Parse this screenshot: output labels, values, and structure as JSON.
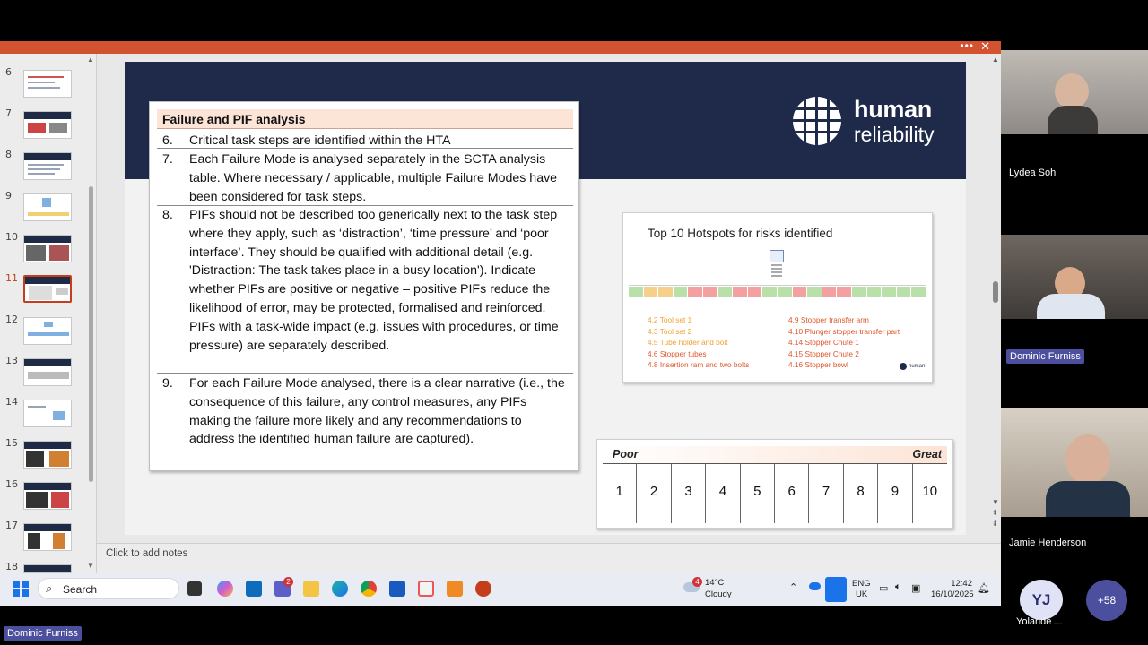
{
  "window": {
    "more_icon": "ellipsis-icon",
    "close_icon": "close-icon"
  },
  "thumbnails": [
    {
      "num": "6"
    },
    {
      "num": "7"
    },
    {
      "num": "8"
    },
    {
      "num": "9"
    },
    {
      "num": "10"
    },
    {
      "num": "11",
      "selected": true
    },
    {
      "num": "12"
    },
    {
      "num": "13"
    },
    {
      "num": "14"
    },
    {
      "num": "15"
    },
    {
      "num": "16"
    },
    {
      "num": "17"
    },
    {
      "num": "18"
    }
  ],
  "slide": {
    "logo": {
      "word1": "human",
      "word2": "reliability"
    },
    "card": {
      "heading": "Failure and PIF analysis",
      "items": [
        {
          "num": "6.",
          "text": "Critical task steps are identified within the HTA"
        },
        {
          "num": "7.",
          "text": "Each Failure Mode is analysed separately in the SCTA analysis table. Where necessary / applicable, multiple Failure Modes have been considered for task steps."
        },
        {
          "num": "8.",
          "text": "PIFs should not be described too generically next to the task step where they apply, such as ‘distraction’, ‘time pressure’ and ‘poor interface’. They should be qualified with additional detail (e.g. 'Distraction: The task takes place in a busy location'). Indicate whether PIFs are positive or negative – positive PIFs reduce the likelihood of error, may be protected, formalised and reinforced. PIFs with a task-wide impact (e.g. issues with procedures, or time pressure) are separately described."
        },
        {
          "num": "9.",
          "text": "For each Failure Mode analysed, there is a clear narrative (i.e., the consequence of this failure, any control measures, any PIFs making the failure more likely and any recommendations to address the identified human failure are captured)."
        }
      ]
    },
    "hotspots": {
      "title": "Top 10 Hotspots for risks identified",
      "left": [
        {
          "text": "4.2 Tool set 1",
          "color": "#f0a030"
        },
        {
          "text": "4.3 Tool set 2",
          "color": "#f0a030"
        },
        {
          "text": "4.5 Tube holder and bolt",
          "color": "#f0a030"
        },
        {
          "text": "4.6 Stopper tubes",
          "color": "#e0552a"
        },
        {
          "text": "4.8 Insertion ram and two bolts",
          "color": "#e0552a"
        }
      ],
      "right": [
        {
          "text": "4.9 Stopper transfer arm",
          "color": "#e0552a"
        },
        {
          "text": "4.10 Plunger stopper transfer part",
          "color": "#e0552a"
        },
        {
          "text": "4.14 Stopper Chute 1",
          "color": "#e0552a"
        },
        {
          "text": "4.15 Stopper Chute 2",
          "color": "#e0552a"
        },
        {
          "text": "4.16 Stopper bowl",
          "color": "#e0552a"
        }
      ],
      "strip_colors": [
        "#b8e0a8",
        "#f5d08a",
        "#f5d08a",
        "#b8e0a8",
        "#f2a0a0",
        "#f2a0a0",
        "#b8e0a8",
        "#f2a0a0",
        "#f2a0a0",
        "#b8e0a8",
        "#b8e0a8",
        "#f2a0a0",
        "#b8e0a8",
        "#f2a0a0",
        "#f2a0a0",
        "#b8e0a8",
        "#b8e0a8",
        "#b8e0a8",
        "#b8e0a8",
        "#b8e0a8"
      ],
      "mini_logo": "human"
    },
    "scale": {
      "low_label": "Poor",
      "high_label": "Great",
      "values": [
        "1",
        "2",
        "3",
        "4",
        "5",
        "6",
        "7",
        "8",
        "9",
        "10"
      ]
    }
  },
  "notes": {
    "placeholder": "Click to add notes"
  },
  "taskbar": {
    "search_label": "Search",
    "weather_temp": "14°C",
    "weather_cond": "Cloudy",
    "weather_badge": "4",
    "teams_badge": "2",
    "lang1": "ENG",
    "lang2": "UK",
    "time": "12:42",
    "date": "16/10/2025"
  },
  "participants": {
    "p1": "Lydea Soh",
    "p2": "Dominic Furniss",
    "p3": "Jamie Henderson",
    "p4_initials": "YJ",
    "p4_name": "Yolande ...",
    "more": "+58",
    "speaker": "Dominic Furniss"
  }
}
